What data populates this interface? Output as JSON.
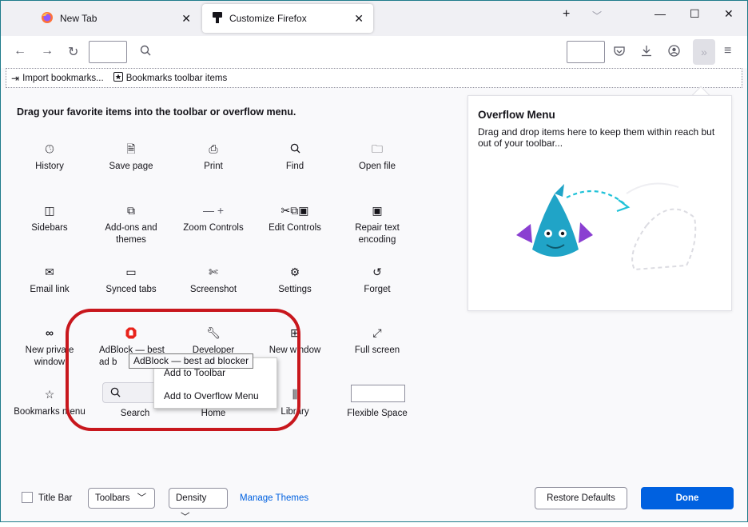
{
  "tabs": [
    {
      "label": "New Tab",
      "icon": "firefox-logo-icon"
    },
    {
      "label": "Customize Firefox",
      "icon": "paintbrush-icon"
    }
  ],
  "window_controls": {
    "new_tab": "+",
    "list_all": "﹀",
    "minimize": "—",
    "maximize": "☐",
    "close": "✕"
  },
  "bookmarks": [
    {
      "label": "Import bookmarks...",
      "icon": "import-icon"
    },
    {
      "label": "Bookmarks toolbar items",
      "icon": "star-box-icon"
    }
  ],
  "palette": {
    "heading": "Drag your favorite items into the toolbar or overflow menu.",
    "items": [
      {
        "label": "History",
        "icon": "clock-icon"
      },
      {
        "label": "Save page",
        "icon": "save-page-icon"
      },
      {
        "label": "Print",
        "icon": "print-icon"
      },
      {
        "label": "Find",
        "icon": "search-icon"
      },
      {
        "label": "Open file",
        "icon": "folder-icon"
      },
      {
        "label": "Sidebars",
        "icon": "sidebar-icon"
      },
      {
        "label": "Add-ons and themes",
        "icon": "puzzle-icon"
      },
      {
        "label": "Zoom Controls",
        "icon": "zoom-controls-icon"
      },
      {
        "label": "Edit Controls",
        "icon": "edit-controls-icon"
      },
      {
        "label": "Repair text encoding",
        "icon": "text-encoding-icon"
      },
      {
        "label": "Email link",
        "icon": "mail-icon"
      },
      {
        "label": "Synced tabs",
        "icon": "synced-tabs-icon"
      },
      {
        "label": "Screenshot",
        "icon": "screenshot-icon"
      },
      {
        "label": "Settings",
        "icon": "gear-icon"
      },
      {
        "label": "Forget",
        "icon": "forget-icon"
      },
      {
        "label": "New private window",
        "icon": "private-mask-icon"
      },
      {
        "label": "AdBlock — best ad b",
        "icon": "adblock-icon"
      },
      {
        "label": "Developer",
        "icon": "wrench-icon"
      },
      {
        "label": "New window",
        "icon": "new-window-icon"
      },
      {
        "label": "Full screen",
        "icon": "fullscreen-icon"
      },
      {
        "label": "Bookmarks menu",
        "icon": "bookmarks-menu-icon"
      },
      {
        "label": "Search",
        "icon": "search-icon"
      },
      {
        "label": "Home",
        "icon": "home-icon"
      },
      {
        "label": "Library",
        "icon": "library-icon"
      },
      {
        "label": "Flexible Space",
        "icon": "none"
      }
    ]
  },
  "overflow_panel": {
    "title": "Overflow Menu",
    "description": "Drag and drop items here to keep them within reach but out of your toolbar..."
  },
  "tooltip": "AdBlock — best ad blocker",
  "context_menu": {
    "add_to_toolbar": "Add to Toolbar",
    "add_to_overflow": "Add to Overflow Menu"
  },
  "footer": {
    "title_bar": "Title Bar",
    "toolbars": "Toolbars",
    "density": "Density",
    "manage_themes": "Manage Themes",
    "restore_defaults": "Restore Defaults",
    "done": "Done"
  },
  "colors": {
    "accent_blue": "#0061e0",
    "highlight_red": "#c8171d",
    "adblock_red": "#e8231b",
    "mascot_teal": "#20a4c7",
    "mascot_purple": "#8a3fd1"
  }
}
